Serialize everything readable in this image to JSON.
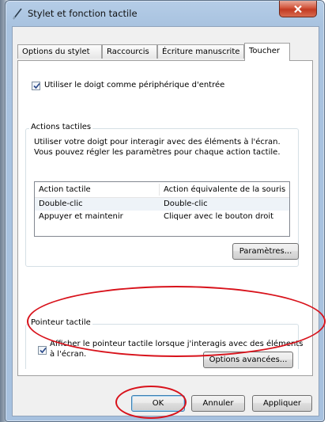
{
  "window": {
    "title": "Stylet et fonction tactile"
  },
  "tabs": [
    {
      "label": "Options du stylet"
    },
    {
      "label": "Raccourcis"
    },
    {
      "label": "Écriture manuscrite"
    },
    {
      "label": "Toucher"
    }
  ],
  "active_tab": "Toucher",
  "touch_input": {
    "label": "Utiliser le doigt comme périphérique d'entrée",
    "checked": true
  },
  "touch_actions": {
    "title": "Actions tactiles",
    "description_line1": "Utiliser votre doigt pour interagir avec des éléments à l'écran.",
    "description_line2": "Vous pouvez régler les paramètres pour chaque action tactile.",
    "columns": [
      "Action tactile",
      "Action équivalente de la souris"
    ],
    "rows": [
      [
        "Double-clic",
        "Double-clic"
      ],
      [
        "Appuyer et maintenir",
        "Cliquer avec le bouton droit"
      ]
    ],
    "settings_button": "Paramètres..."
  },
  "touch_pointer": {
    "title": "Pointeur tactile",
    "checkbox_label_line1": "Afficher le pointeur tactile lorsque j'interagis avec des éléments",
    "checkbox_label_line2": "à l'écran.",
    "checked": true,
    "advanced_button": "Options avancées..."
  },
  "footer": {
    "ok": "OK",
    "cancel": "Annuler",
    "apply": "Appliquer"
  },
  "colors": {
    "highlight_ellipse": "#d8121b",
    "close_button": "#c23b23"
  }
}
